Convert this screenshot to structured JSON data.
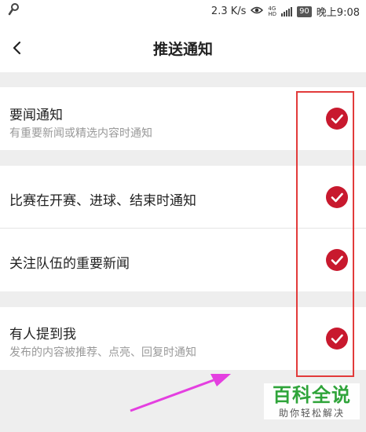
{
  "status_bar": {
    "speed": "2.3 K/s",
    "net_tag_top": "4G",
    "net_tag_bottom": "HD",
    "battery": "90",
    "time": "晚上9:08"
  },
  "nav": {
    "title": "推送通知"
  },
  "settings": [
    {
      "title": "要闻通知",
      "subtitle": "有重要新闻或精选内容时通知",
      "enabled": true
    },
    {
      "title": "比赛在开赛、进球、结束时通知",
      "subtitle": "",
      "enabled": true
    },
    {
      "title": "关注队伍的重要新闻",
      "subtitle": "",
      "enabled": true
    },
    {
      "title": "有人提到我",
      "subtitle": "发布的内容被推荐、点亮、回复时通知",
      "enabled": true
    }
  ],
  "watermark": {
    "main": "百科全说",
    "sub": "助你轻松解决"
  },
  "colors": {
    "accent": "#c8192e",
    "highlight": "#e23b3b",
    "arrow": "#e43fe0",
    "watermark": "#2fa43a"
  }
}
